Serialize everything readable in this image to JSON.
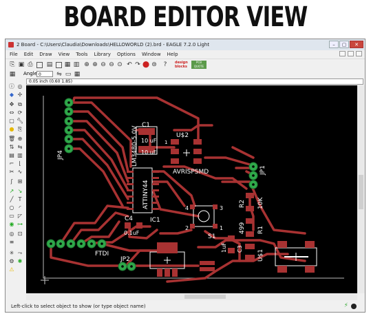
{
  "heading": "BOARD EDITOR VIEW",
  "window": {
    "title": "2 Board - C:\\Users\\Claudia\\Downloads\\HELLOWORLD (2).brd - EAGLE 7.2.0 Light",
    "controls": {
      "minimize": "–",
      "maximize": "▢",
      "close": "✕"
    }
  },
  "menu": [
    "File",
    "Edit",
    "Draw",
    "View",
    "Tools",
    "Library",
    "Options",
    "Window",
    "Help"
  ],
  "toolbar": {
    "logo_text": "design blocks",
    "logo2_text": "PCB QUOTE"
  },
  "angle": {
    "label": "Angle:",
    "value": "0"
  },
  "coordinates": "0.05 inch (0.60 1.85)",
  "status": "Left-click to select object to show (or type object name)",
  "board": {
    "colors": {
      "trace": "#a83232",
      "pad": "#2fa84a",
      "silk": "#ffffff",
      "background": "#000000"
    },
    "labels": {
      "jp4": "JP4",
      "c1": "C1",
      "c1_val": "10 uF",
      "c1_val2": "10 uF",
      "u2": "U$2",
      "u2_pin": "1",
      "regulator": "LM3480-5.0V",
      "avr": "AVRISPSMD",
      "jp1": "JP1",
      "ic_name": "ATTINY44",
      "ic": "IC1",
      "c4": "C4",
      "c4_val": "0.1uF",
      "r2": "R2",
      "r2_val": "10K",
      "sw": "S1",
      "sw_p4": "4",
      "sw_p3": "3",
      "sw_p2": "2",
      "sw_p1": "1",
      "r1": "R1",
      "r1_val": "499",
      "c3": "C3",
      "c3_val": "1uF",
      "u1": "U$1",
      "ftdi": "FTDI",
      "jp2": "JP2"
    }
  }
}
